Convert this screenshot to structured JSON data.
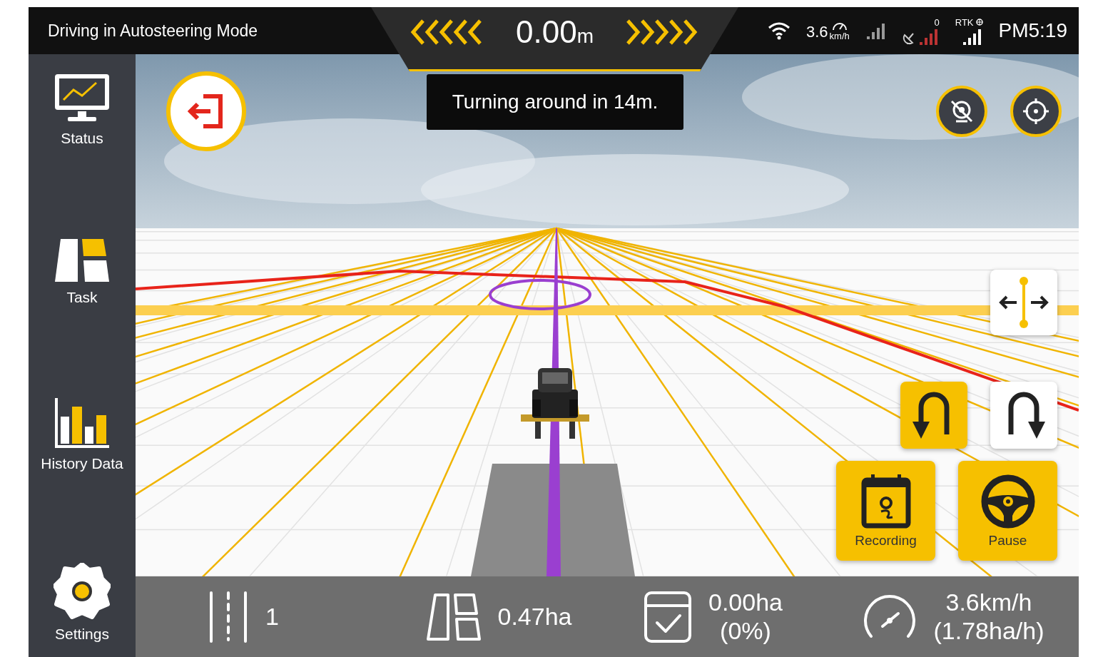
{
  "top_bar": {
    "title": "Driving in Autosteering Mode",
    "offset": {
      "value": "0.00",
      "unit": "m"
    },
    "speed": {
      "value": "3.6",
      "unit": "km/h"
    },
    "satellites": "0",
    "rtk": "RTK",
    "time": "PM5:19"
  },
  "notice": "Turning around in 14m.",
  "sidebar": {
    "items": [
      {
        "label": "Status",
        "kind": "status"
      },
      {
        "label": "Task",
        "kind": "task"
      },
      {
        "label": "History Data",
        "kind": "history"
      },
      {
        "label": "Settings",
        "kind": "settings"
      }
    ]
  },
  "turn_buttons": [
    {
      "kind": "left",
      "selected": true
    },
    {
      "kind": "right",
      "selected": false
    }
  ],
  "actions": [
    {
      "label": "Recording",
      "kind": "recording"
    },
    {
      "label": "Pause",
      "kind": "pause"
    }
  ],
  "stats": [
    {
      "kind": "lines",
      "value": "1"
    },
    {
      "kind": "area",
      "value": "0.47ha"
    },
    {
      "kind": "done",
      "value": "0.00ha",
      "note": "(0%)"
    },
    {
      "kind": "speed",
      "value": "3.6km/h",
      "note": "(1.78ha/h)"
    }
  ]
}
